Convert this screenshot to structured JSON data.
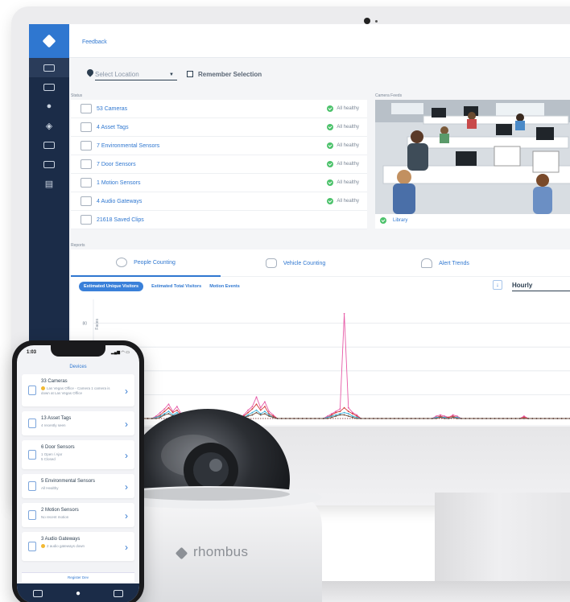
{
  "colors": {
    "accent": "#2f77d0",
    "sidebar": "#1b2c48",
    "healthy": "#4cc26b",
    "warn": "#f2b933"
  },
  "header": {
    "feedback_link": "Feedback"
  },
  "location": {
    "placeholder": "Select Location",
    "remember_label": "Remember Selection"
  },
  "sidebar": {
    "items": [
      {
        "icon": "camera-icon",
        "active": true
      },
      {
        "icon": "vehicle-icon"
      },
      {
        "icon": "location-pin-icon"
      },
      {
        "icon": "map-icon"
      },
      {
        "icon": "grid-icon"
      },
      {
        "icon": "clips-icon"
      },
      {
        "icon": "document-icon"
      }
    ]
  },
  "status": {
    "heading": "Status",
    "rows": [
      {
        "icon": "camera-icon",
        "label": "53 Cameras",
        "status": "All healthy"
      },
      {
        "icon": "asset-tag-icon",
        "label": "4 Asset Tags",
        "status": "All healthy"
      },
      {
        "icon": "environmental-sensor-icon",
        "label": "7 Environmental Sensors",
        "status": "All healthy"
      },
      {
        "icon": "door-sensor-icon",
        "label": "7 Door Sensors",
        "status": "All healthy"
      },
      {
        "icon": "motion-sensor-icon",
        "label": "1 Motion Sensors",
        "status": "All healthy"
      },
      {
        "icon": "audio-gateway-icon",
        "label": "4 Audio Gateways",
        "status": "All healthy"
      },
      {
        "icon": "saved-clips-icon",
        "label": "21618 Saved Clips",
        "status": ""
      }
    ]
  },
  "feeds": {
    "heading": "Camera Feeds",
    "caption": "Library"
  },
  "reports": {
    "heading": "Reports",
    "tabs": [
      {
        "icon": "people-counting-icon",
        "label": "People Counting",
        "active": true
      },
      {
        "icon": "vehicle-counting-icon",
        "label": "Vehicle Counting"
      },
      {
        "icon": "bell-icon",
        "label": "Alert Trends"
      }
    ],
    "filters": [
      "Estimated Unique Visitors",
      "Estimated Total Visitors",
      "Motion Events"
    ],
    "interval": "Hourly"
  },
  "chart_data": {
    "type": "line",
    "ylabel": "Faces",
    "yticks": [
      80,
      60
    ],
    "ylim": [
      0,
      100
    ],
    "x": [
      0,
      1,
      2,
      3,
      4,
      5,
      6,
      7,
      8,
      9,
      10,
      11,
      12,
      13,
      14,
      15,
      16,
      17,
      18,
      19,
      20,
      21,
      22,
      23,
      24,
      25,
      26,
      27,
      28,
      29,
      30,
      31,
      32,
      33,
      34,
      35,
      36,
      37,
      38,
      39,
      40,
      41,
      42,
      43,
      44,
      45,
      46,
      47,
      48,
      49,
      50,
      51,
      52,
      53,
      54,
      55,
      56,
      57,
      58,
      59,
      60,
      61,
      62,
      63,
      64,
      65,
      66,
      67,
      68,
      69,
      70,
      71,
      72,
      73,
      74,
      75,
      76,
      77,
      78,
      79,
      80,
      81,
      82,
      83,
      84,
      85,
      86,
      87,
      88,
      89,
      90,
      91,
      92,
      93,
      94,
      95,
      96,
      97,
      98,
      99,
      100,
      101,
      102,
      103,
      104,
      105,
      106,
      107,
      108,
      109,
      110,
      111,
      112,
      113,
      114,
      115,
      116,
      117,
      118,
      119
    ],
    "series": [
      {
        "color": "#e75aa7",
        "values": [
          0,
          0,
          0,
          0,
          0,
          0,
          0,
          0,
          0,
          0,
          0,
          0,
          0,
          0,
          0,
          2,
          5,
          8,
          12,
          6,
          10,
          4,
          2,
          0,
          0,
          0,
          0,
          0,
          0,
          0,
          0,
          0,
          0,
          0,
          0,
          0,
          3,
          7,
          10,
          18,
          9,
          14,
          6,
          3,
          0,
          0,
          0,
          0,
          0,
          0,
          0,
          0,
          0,
          0,
          0,
          0,
          2,
          4,
          6,
          8,
          88,
          9,
          5,
          3,
          0,
          0,
          0,
          0,
          0,
          0,
          0,
          0,
          0,
          0,
          0,
          0,
          0,
          0,
          0,
          0,
          0,
          0,
          2,
          3,
          2,
          1,
          3,
          2,
          0,
          0,
          0,
          0,
          0,
          0,
          0,
          0,
          0,
          0,
          0,
          0,
          0,
          0,
          0,
          2,
          0,
          0,
          0,
          0,
          0,
          0,
          0,
          0,
          0,
          0,
          0,
          0,
          0,
          0,
          0,
          0
        ]
      },
      {
        "color": "#d23a3a",
        "values": [
          0,
          0,
          0,
          0,
          0,
          0,
          0,
          0,
          0,
          0,
          0,
          0,
          0,
          0,
          0,
          1,
          3,
          6,
          9,
          5,
          7,
          3,
          1,
          0,
          0,
          0,
          0,
          0,
          0,
          0,
          0,
          0,
          0,
          0,
          0,
          0,
          2,
          5,
          8,
          12,
          7,
          10,
          4,
          2,
          0,
          0,
          0,
          0,
          0,
          0,
          0,
          0,
          0,
          0,
          0,
          0,
          1,
          3,
          5,
          6,
          9,
          6,
          4,
          2,
          0,
          0,
          0,
          0,
          0,
          0,
          0,
          0,
          0,
          0,
          0,
          0,
          0,
          0,
          0,
          0,
          0,
          0,
          1,
          2,
          1,
          1,
          2,
          1,
          0,
          0,
          0,
          0,
          0,
          0,
          0,
          0,
          0,
          0,
          0,
          0,
          0,
          0,
          0,
          1,
          0,
          0,
          0,
          0,
          0,
          0,
          0,
          0,
          0,
          0,
          0,
          0,
          0,
          0,
          0,
          0
        ]
      },
      {
        "color": "#3aaed8",
        "values": [
          0,
          0,
          0,
          0,
          0,
          0,
          0,
          0,
          0,
          0,
          0,
          0,
          0,
          0,
          0,
          1,
          2,
          4,
          6,
          3,
          5,
          2,
          1,
          0,
          0,
          0,
          0,
          0,
          0,
          0,
          0,
          0,
          0,
          0,
          0,
          0,
          1,
          3,
          5,
          7,
          4,
          6,
          3,
          1,
          0,
          0,
          0,
          0,
          0,
          0,
          0,
          0,
          0,
          0,
          0,
          0,
          1,
          2,
          3,
          4,
          5,
          4,
          2,
          1,
          0,
          0,
          0,
          0,
          0,
          0,
          0,
          0,
          0,
          0,
          0,
          0,
          0,
          0,
          0,
          0,
          0,
          0,
          1,
          1,
          1,
          0,
          1,
          1,
          0,
          0,
          0,
          0,
          0,
          0,
          0,
          0,
          0,
          0,
          0,
          0,
          0,
          0,
          0,
          0,
          0,
          0,
          0,
          0,
          0,
          0,
          0,
          0,
          0,
          0,
          0,
          0,
          0,
          0,
          0,
          0
        ]
      },
      {
        "color": "#6a4a3a",
        "values": [
          0,
          0,
          0,
          0,
          0,
          0,
          0,
          0,
          0,
          0,
          0,
          0,
          0,
          0,
          0,
          0,
          1,
          3,
          4,
          2,
          3,
          1,
          0,
          0,
          0,
          0,
          0,
          0,
          0,
          0,
          0,
          0,
          0,
          0,
          0,
          0,
          1,
          2,
          3,
          5,
          3,
          4,
          2,
          1,
          0,
          0,
          0,
          0,
          0,
          0,
          0,
          0,
          0,
          0,
          0,
          0,
          0,
          1,
          2,
          3,
          3,
          2,
          1,
          0,
          0,
          0,
          0,
          0,
          0,
          0,
          0,
          0,
          0,
          0,
          0,
          0,
          0,
          0,
          0,
          0,
          0,
          0,
          0,
          1,
          0,
          0,
          1,
          0,
          0,
          0,
          0,
          0,
          0,
          0,
          0,
          0,
          0,
          0,
          0,
          0,
          0,
          0,
          0,
          0,
          0,
          0,
          0,
          0,
          0,
          0,
          0,
          0,
          0,
          0,
          0,
          0,
          0,
          0,
          0,
          0
        ]
      }
    ]
  },
  "phone": {
    "time": "1:03",
    "status_icons": "▂▄▆ ◠ ▭",
    "title": "Devices",
    "cards": [
      {
        "icon": "camera-icon",
        "title": "33 Cameras",
        "sub": "Las Vegas Office - Camera 1 camera is down at Las Vegas Office",
        "warn": true,
        "chevron": "›"
      },
      {
        "icon": "asset-tag-icon",
        "title": "13 Asset Tags",
        "sub": "4 recently seen",
        "chevron": "›"
      },
      {
        "icon": "door-sensor-icon",
        "title": "6 Door Sensors",
        "sub": "1 Open / Ajar\n5 Closed",
        "chevron": "›"
      },
      {
        "icon": "environmental-sensor-icon",
        "title": "5 Environmental Sensors",
        "sub": "All Healthy",
        "chevron": "›"
      },
      {
        "icon": "motion-sensor-icon",
        "title": "2 Motion Sensors",
        "sub": "No recent motion",
        "chevron": "›"
      },
      {
        "icon": "audio-gateway-icon",
        "title": "3 Audio Gateways",
        "sub": "2 audio gateways down",
        "warn": true,
        "chevron": "›"
      }
    ],
    "register_label": "Register Dev"
  },
  "dome": {
    "brand": "rhombus"
  }
}
